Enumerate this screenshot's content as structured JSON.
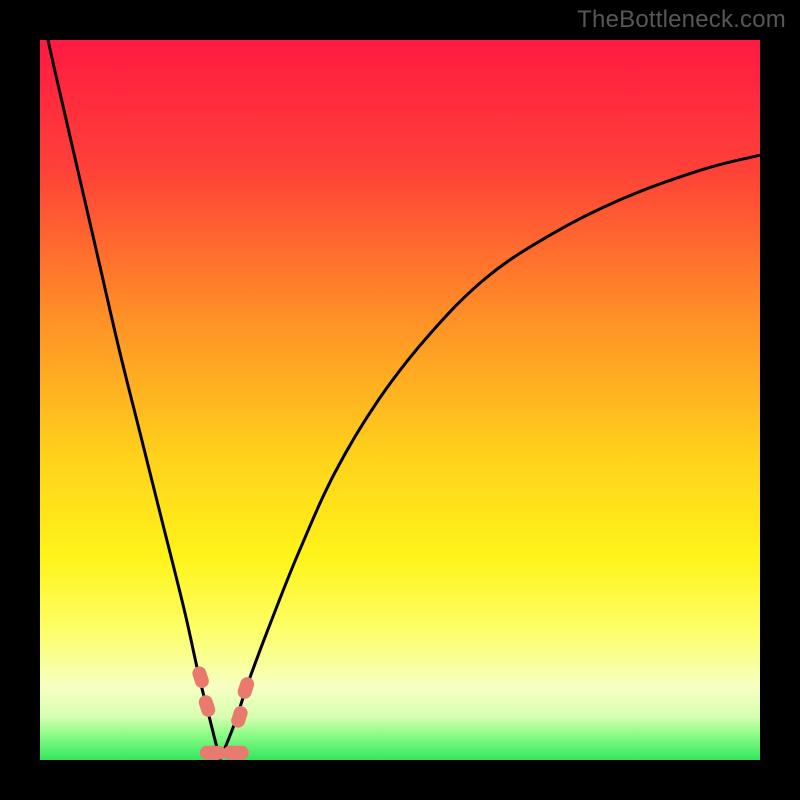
{
  "watermark": "TheBottleneck.com",
  "colors": {
    "gradient_stops": [
      {
        "pct": 0,
        "hex": "#ff1a42"
      },
      {
        "pct": 18,
        "hex": "#ff4138"
      },
      {
        "pct": 38,
        "hex": "#ff8e27"
      },
      {
        "pct": 58,
        "hex": "#ffd21b"
      },
      {
        "pct": 72,
        "hex": "#fff41a"
      },
      {
        "pct": 82,
        "hex": "#fdff68"
      },
      {
        "pct": 90,
        "hex": "#f6ffc2"
      },
      {
        "pct": 94,
        "hex": "#d6ffb0"
      },
      {
        "pct": 96.5,
        "hex": "#8cfc86"
      },
      {
        "pct": 100,
        "hex": "#32e65f"
      }
    ],
    "curve_stroke": "#000000",
    "marker_fill": "#e87a6e",
    "frame_bg": "#000000"
  },
  "chart_data": {
    "type": "line",
    "title": "",
    "xlabel": "",
    "ylabel": "",
    "xlim": [
      0,
      100
    ],
    "ylim": [
      0,
      100
    ],
    "notes": "Bottleneck-style V-curve. Axis values are normalized 0–100 (no numeric ticks rendered). y≈0 is optimal (green), y≈100 is worst (red). Minimum near x≈25.",
    "series": [
      {
        "name": "left-branch",
        "x": [
          0,
          2,
          5,
          8,
          11,
          14,
          17,
          20,
          22,
          23.5,
          25
        ],
        "y": [
          105,
          96,
          83,
          70,
          57,
          45,
          33,
          21,
          12,
          6,
          0
        ]
      },
      {
        "name": "right-branch",
        "x": [
          25,
          27,
          29,
          32,
          36,
          41,
          47,
          54,
          62,
          71,
          81,
          92,
          100
        ],
        "y": [
          0,
          5,
          11,
          19,
          29,
          40,
          50,
          59,
          67,
          73,
          78,
          82,
          84
        ]
      }
    ],
    "markers": [
      {
        "name": "left-cap-top",
        "x": 22.3,
        "y": 11.5
      },
      {
        "name": "left-cap-bottom",
        "x": 23.2,
        "y": 7.5
      },
      {
        "name": "right-cap-top",
        "x": 28.6,
        "y": 10.0
      },
      {
        "name": "right-cap-bottom",
        "x": 27.7,
        "y": 6.0
      },
      {
        "name": "floor-left",
        "x": 24.0,
        "y": 1.0
      },
      {
        "name": "floor-right",
        "x": 27.2,
        "y": 1.0
      }
    ]
  }
}
